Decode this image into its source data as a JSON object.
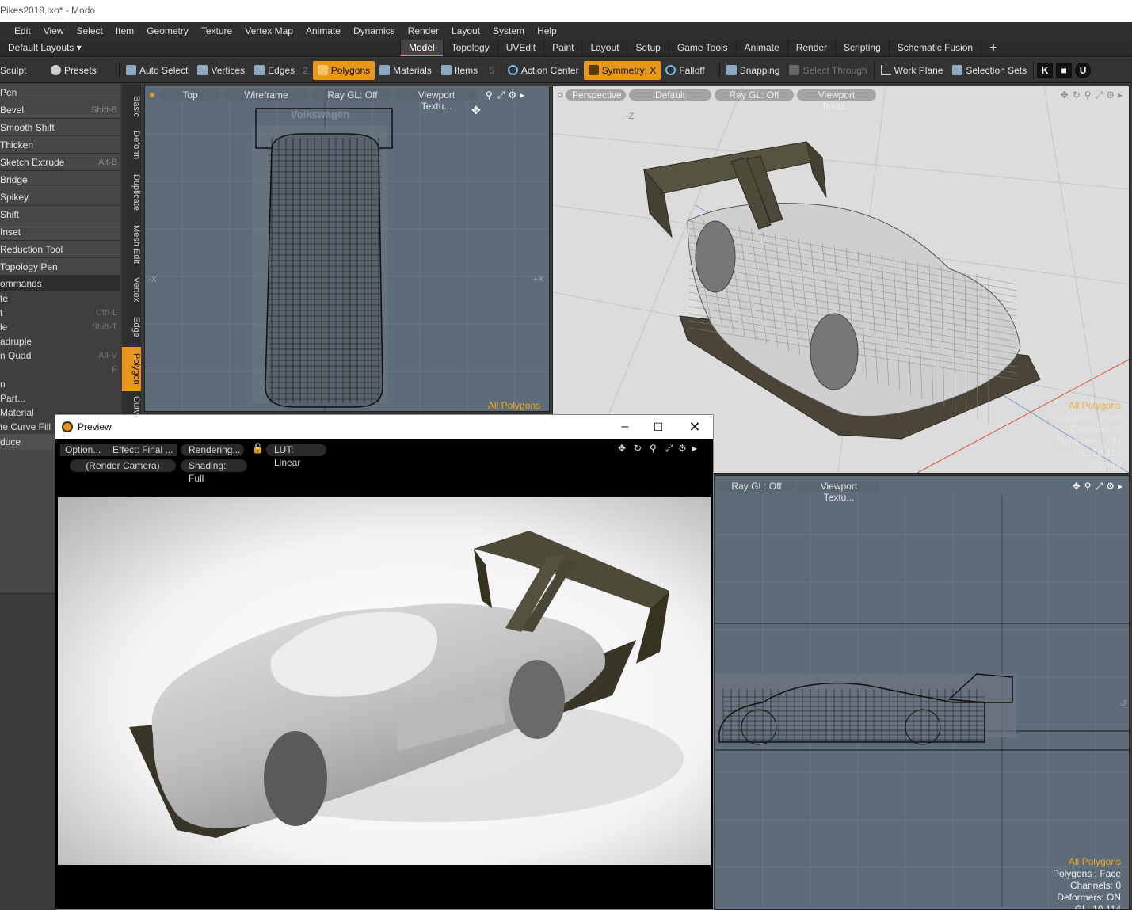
{
  "window": {
    "title": "Pikes2018.lxo* - Modo"
  },
  "menu": [
    "Edit",
    "View",
    "Select",
    "Item",
    "Geometry",
    "Texture",
    "Vertex Map",
    "Animate",
    "Dynamics",
    "Render",
    "Layout",
    "System",
    "Help"
  ],
  "layouts": {
    "selector": "Default Layouts ▾",
    "tabs": [
      "Model",
      "Topology",
      "UVEdit",
      "Paint",
      "Layout",
      "Setup",
      "Game Tools",
      "Animate",
      "Render",
      "Scripting",
      "Schematic Fusion"
    ],
    "active": "Model",
    "add": "+"
  },
  "toolbar": {
    "sculpt": "Sculpt",
    "presets": "Presets",
    "auto_select": "Auto Select",
    "vertices": "Vertices",
    "edges": "Edges",
    "edges_count": "2",
    "polygons": "Polygons",
    "materials": "Materials",
    "items": "Items",
    "items_count": "5",
    "action_center": "Action Center",
    "symmetry": "Symmetry: X",
    "falloff": "Falloff",
    "snapping": "Snapping",
    "select_through": "Select Through",
    "work_plane": "Work Plane",
    "selection_sets": "Selection Sets"
  },
  "tools": [
    {
      "label": "Pen",
      "key": ""
    },
    {
      "label": "Bevel",
      "key": "Shift-B"
    },
    {
      "label": "Smooth Shift",
      "key": ""
    },
    {
      "label": "Thicken",
      "key": ""
    },
    {
      "label": "Sketch Extrude",
      "key": "Alt-B"
    },
    {
      "label": "Bridge",
      "key": ""
    },
    {
      "label": "Spikey",
      "key": ""
    },
    {
      "label": "Shift",
      "key": ""
    },
    {
      "label": "Inset",
      "key": ""
    },
    {
      "label": "Reduction Tool",
      "key": ""
    },
    {
      "label": "Topology Pen",
      "key": ""
    }
  ],
  "commands": {
    "header": "ommands",
    "items": [
      {
        "label": "te",
        "key": ""
      },
      {
        "label": "t",
        "key": "Ctrl-L"
      },
      {
        "label": "le",
        "key": "Shift-T"
      },
      {
        "label": "adruple",
        "key": ""
      },
      {
        "label": "n Quad",
        "key": "Alt-V"
      },
      {
        "label": "",
        "key": "F"
      },
      {
        "label": "n",
        "key": ""
      },
      {
        "label": " Part...",
        "key": ""
      },
      {
        "label": " Material",
        "key": ""
      },
      {
        "label": "te Curve Fill",
        "key": ""
      }
    ],
    "footer": "duce"
  },
  "vtabs": [
    "Basic",
    "Deform",
    "Duplicate",
    "Mesh Edit",
    "Vertex",
    "Edge",
    "Polygon",
    "Curv"
  ],
  "vp_top": {
    "view": "Top",
    "shading": "Wireframe",
    "raygl": "Ray GL: Off",
    "tex": "Viewport Textu...",
    "axis_left": "-X",
    "axis_right": "+X",
    "status": "All Polygons",
    "decal": "Volkswagen"
  },
  "vp_persp": {
    "view": "Perspective",
    "shading": "Default",
    "raygl": "Ray GL: Off",
    "tex": "Viewport Textu...",
    "axis": "-Z",
    "info": [
      "All Polygons",
      "Polygons : Face",
      "Channels: 0",
      "Deformers: ON",
      "GL: 10,114",
      "500 mm"
    ]
  },
  "vp_side": {
    "raygl": "Ray GL: Off",
    "tex": "Viewport Textu...",
    "axis": "-Z",
    "info": [
      "All Polygons",
      "Polygons : Face",
      "Channels: 0",
      "Deformers: ON",
      "GL: 10,114"
    ]
  },
  "preview": {
    "title": "Preview",
    "options": "Option...",
    "effect": "Effect: Final ...",
    "rendering": "Rendering...",
    "lut": "LUT: Linear",
    "camera": "(Render Camera)",
    "shading": "Shading: Full"
  },
  "colors": {
    "accent": "#e7981c",
    "viewport_bg": "#5e6b78",
    "persp_bg": "#dcdcdc",
    "info_orange": "#e5a01b"
  }
}
